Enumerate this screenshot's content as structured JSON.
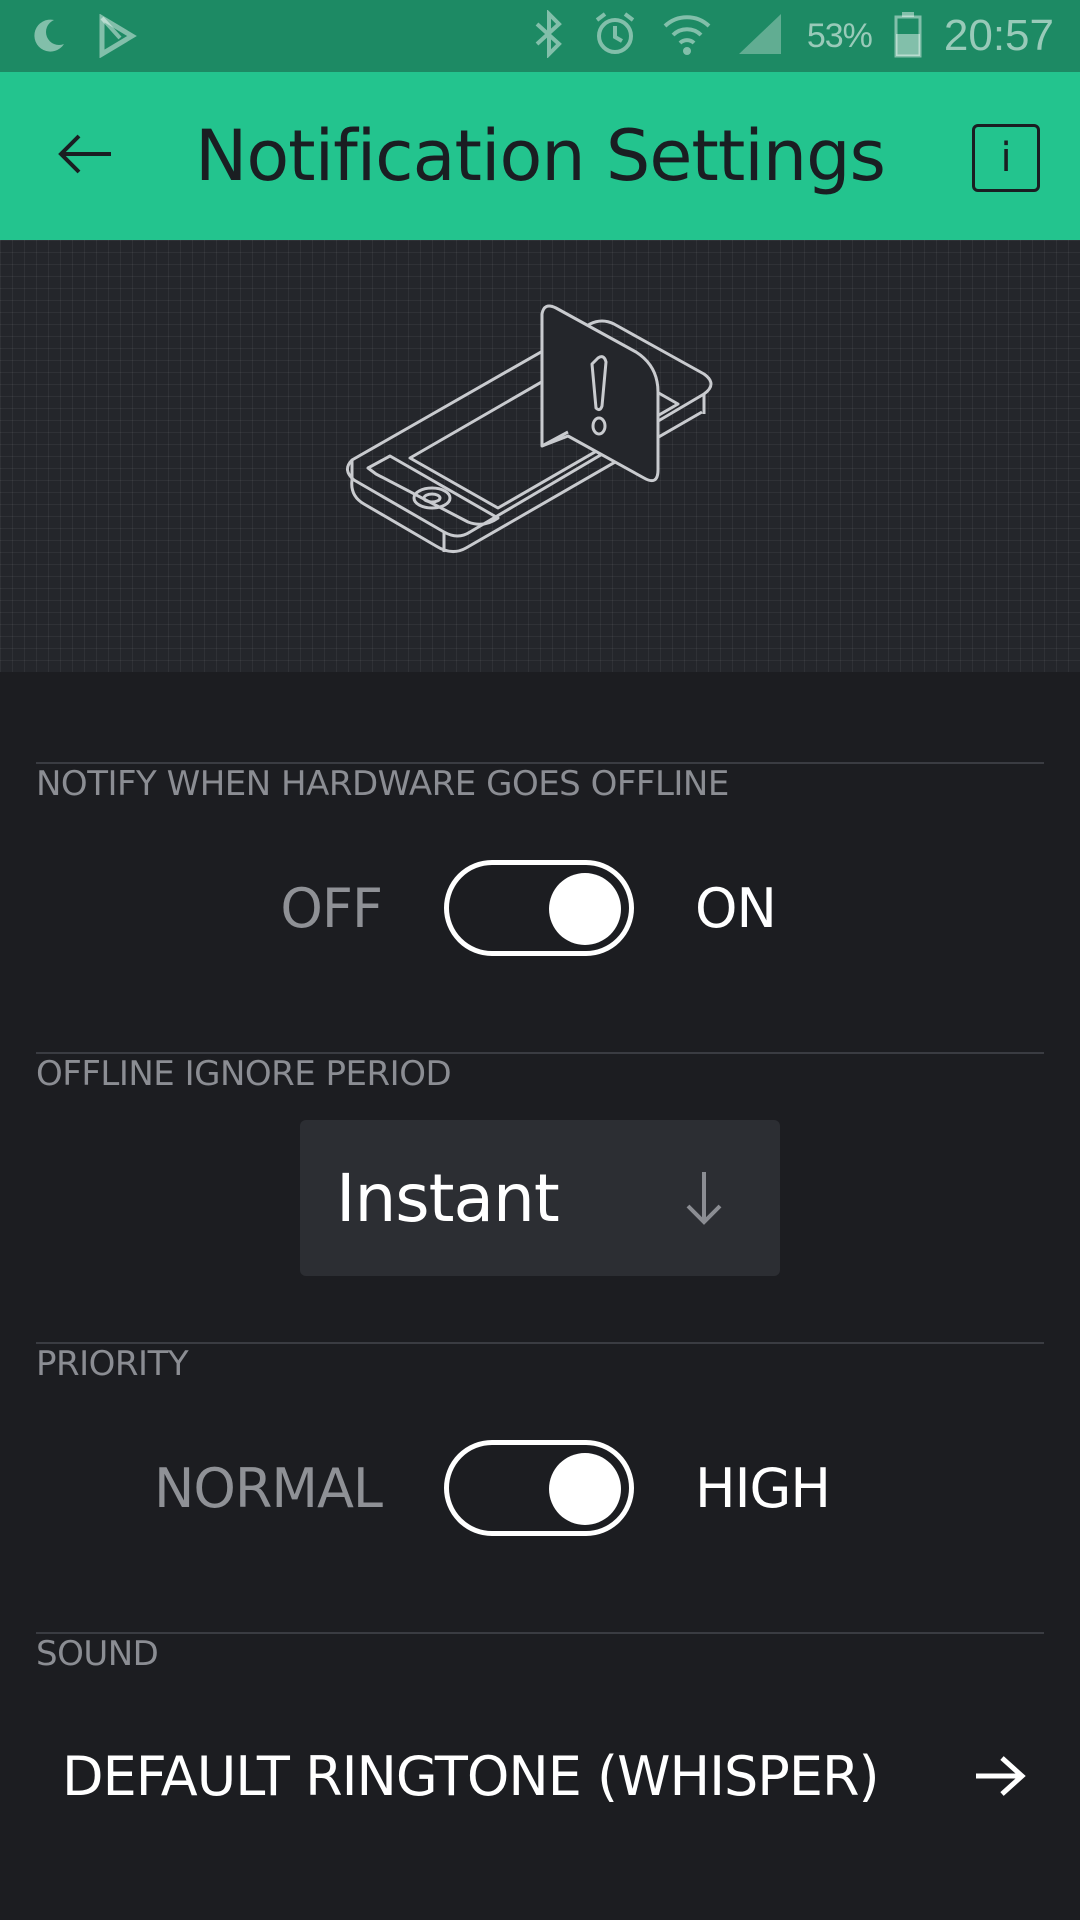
{
  "status_bar": {
    "battery_percent": "53%",
    "time": "20:57",
    "icons": [
      "moon-icon",
      "play-store-icon",
      "bluetooth-icon",
      "alarm-icon",
      "wifi-icon",
      "signal-icon",
      "battery-icon"
    ]
  },
  "app_bar": {
    "title": "Notification Settings",
    "back_icon": "arrow-left-icon",
    "info_label": "i",
    "background": "#23c48e"
  },
  "hero": {
    "illustration": "phone-with-alert-icon"
  },
  "sections": {
    "offline_notify": {
      "label": "NOTIFY WHEN HARDWARE GOES OFFLINE",
      "off_label": "OFF",
      "on_label": "ON",
      "state": "on"
    },
    "ignore_period": {
      "label": "OFFLINE IGNORE PERIOD",
      "value": "Instant",
      "arrow_icon": "arrow-down-icon"
    },
    "priority": {
      "label": "PRIORITY",
      "low_label": "NORMAL",
      "high_label": "HIGH",
      "state": "high"
    },
    "sound": {
      "label": "SOUND",
      "value": "DEFAULT RINGTONE (WHISPER)",
      "arrow_icon": "arrow-right-icon"
    }
  },
  "colors": {
    "background": "#1c1d21",
    "accent": "#23c48e",
    "label": "#8b8d93"
  }
}
